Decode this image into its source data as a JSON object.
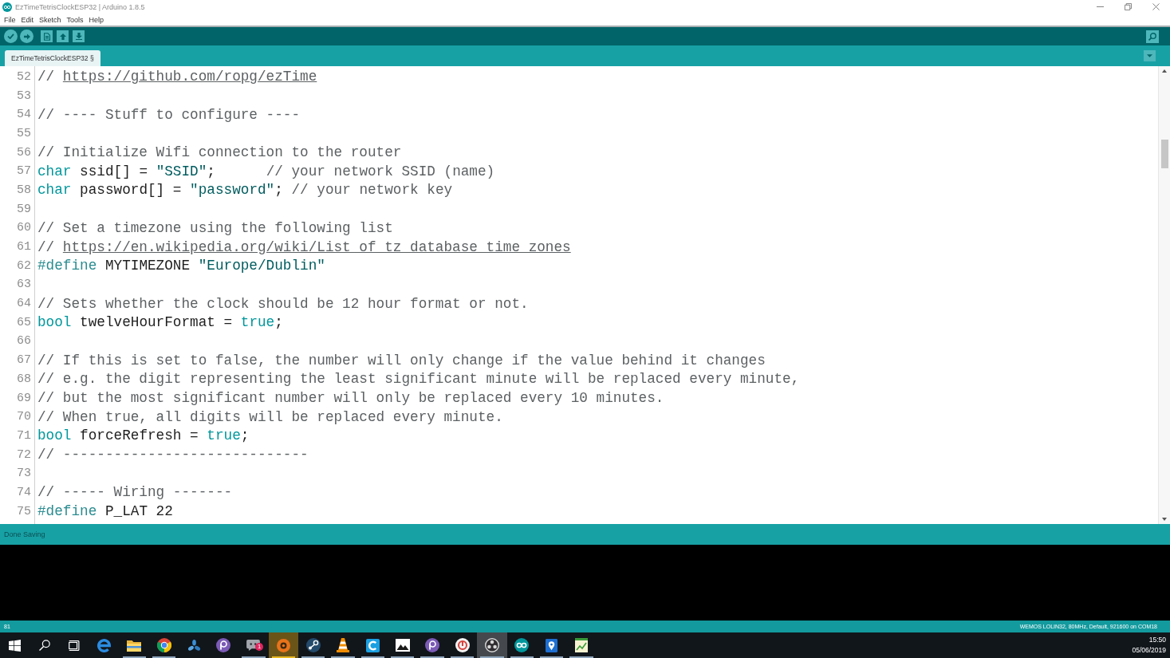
{
  "window": {
    "title": "EzTimeTetrisClockESP32 | Arduino 1.8.5"
  },
  "menu": [
    "File",
    "Edit",
    "Sketch",
    "Tools",
    "Help"
  ],
  "tabs": [
    {
      "label": "EzTimeTetrisClockESP32 §",
      "selected": true
    }
  ],
  "editor": {
    "lines": [
      {
        "number": "52",
        "tokens": [
          {
            "kind": "comment",
            "text": "// "
          },
          {
            "kind": "link",
            "text": "https://github.com/ropg/ezTime"
          }
        ]
      },
      {
        "number": "53"
      },
      {
        "number": "54",
        "tokens": [
          {
            "kind": "comment",
            "text": "// ---- Stuff to configure ----"
          }
        ]
      },
      {
        "number": "55"
      },
      {
        "number": "56",
        "tokens": [
          {
            "kind": "comment",
            "text": "// Initialize Wifi connection to the router"
          }
        ]
      },
      {
        "number": "57",
        "tokens": [
          {
            "kind": "keyword",
            "text": "char"
          },
          {
            "kind": "plain",
            "text": " ssid[] = "
          },
          {
            "kind": "string",
            "text": "\"SSID\""
          },
          {
            "kind": "plain",
            "text": ";      "
          },
          {
            "kind": "comment",
            "text": "// your network SSID (name)"
          }
        ]
      },
      {
        "number": "58",
        "tokens": [
          {
            "kind": "keyword",
            "text": "char"
          },
          {
            "kind": "plain",
            "text": " password[] = "
          },
          {
            "kind": "string",
            "text": "\"password\""
          },
          {
            "kind": "plain",
            "text": "; "
          },
          {
            "kind": "comment",
            "text": "// your network key"
          }
        ]
      },
      {
        "number": "59"
      },
      {
        "number": "60",
        "tokens": [
          {
            "kind": "comment",
            "text": "// Set a timezone using the following list"
          }
        ]
      },
      {
        "number": "61",
        "tokens": [
          {
            "kind": "comment",
            "text": "// "
          },
          {
            "kind": "link",
            "text": "https://en.wikipedia.org/wiki/List_of_tz_database_time_zones"
          }
        ]
      },
      {
        "number": "62",
        "tokens": [
          {
            "kind": "directive",
            "text": "#define"
          },
          {
            "kind": "plain",
            "text": " MYTIMEZONE "
          },
          {
            "kind": "string",
            "text": "\"Europe/Dublin\""
          }
        ]
      },
      {
        "number": "63"
      },
      {
        "number": "64",
        "tokens": [
          {
            "kind": "comment",
            "text": "// Sets whether the clock should be 12 hour format or not."
          }
        ]
      },
      {
        "number": "65",
        "tokens": [
          {
            "kind": "keyword",
            "text": "bool"
          },
          {
            "kind": "plain",
            "text": " twelveHourFormat = "
          },
          {
            "kind": "literal",
            "text": "true"
          },
          {
            "kind": "plain",
            "text": ";"
          }
        ]
      },
      {
        "number": "66"
      },
      {
        "number": "67",
        "tokens": [
          {
            "kind": "comment",
            "text": "// If this is set to false, the number will only change if the value behind it changes"
          }
        ]
      },
      {
        "number": "68",
        "tokens": [
          {
            "kind": "comment",
            "text": "// e.g. the digit representing the least significant minute will be replaced every minute,"
          }
        ]
      },
      {
        "number": "69",
        "tokens": [
          {
            "kind": "comment",
            "text": "// but the most significant number will only be replaced every 10 minutes."
          }
        ]
      },
      {
        "number": "70",
        "tokens": [
          {
            "kind": "comment",
            "text": "// When true, all digits will be replaced every minute."
          }
        ]
      },
      {
        "number": "71",
        "tokens": [
          {
            "kind": "keyword",
            "text": "bool"
          },
          {
            "kind": "plain",
            "text": " forceRefresh = "
          },
          {
            "kind": "literal",
            "text": "true"
          },
          {
            "kind": "plain",
            "text": ";"
          }
        ]
      },
      {
        "number": "72",
        "tokens": [
          {
            "kind": "comment",
            "text": "// -----------------------------"
          }
        ]
      },
      {
        "number": "73"
      },
      {
        "number": "74",
        "tokens": [
          {
            "kind": "comment",
            "text": "// ----- Wiring -------"
          }
        ]
      },
      {
        "number": "75",
        "tokens": [
          {
            "kind": "directive",
            "text": "#define"
          },
          {
            "kind": "plain",
            "text": " P_LAT 22"
          }
        ]
      }
    ]
  },
  "status_bar": {
    "message": "Done Saving"
  },
  "footer": {
    "line": "81",
    "board": "WEMOS LOLIN32, 80MHz, Default, 921600 on COM18"
  },
  "taskbar": {
    "items": [
      {
        "kind": "start",
        "running": false,
        "attention": false,
        "hovered": false
      },
      {
        "kind": "search",
        "running": false,
        "attention": false,
        "hovered": false
      },
      {
        "kind": "taskview",
        "running": false,
        "attention": false,
        "hovered": false
      },
      {
        "kind": "e-browser",
        "running": false,
        "attention": false,
        "hovered": false
      },
      {
        "kind": "folder",
        "running": true,
        "attention": false,
        "hovered": false
      },
      {
        "kind": "ring-browser",
        "running": true,
        "attention": false,
        "hovered": false
      },
      {
        "kind": "fan",
        "running": false,
        "attention": false,
        "hovered": false
      },
      {
        "kind": "disc",
        "running": false,
        "attention": false,
        "hovered": false
      },
      {
        "kind": "chat",
        "running": true,
        "attention": false,
        "hovered": false,
        "badge": "1"
      },
      {
        "kind": "target",
        "running": true,
        "attention": true,
        "hovered": false
      },
      {
        "kind": "link-circle",
        "running": true,
        "attention": false,
        "hovered": false
      },
      {
        "kind": "cone",
        "running": true,
        "attention": false,
        "hovered": false
      },
      {
        "kind": "arc-tile",
        "running": true,
        "attention": false,
        "hovered": false
      },
      {
        "kind": "image",
        "running": true,
        "attention": false,
        "hovered": false
      },
      {
        "kind": "disc",
        "running": true,
        "attention": false,
        "hovered": false
      },
      {
        "kind": "ring",
        "running": true,
        "attention": false,
        "hovered": false
      },
      {
        "kind": "dots",
        "running": true,
        "attention": false,
        "hovered": true
      },
      {
        "kind": "infinity",
        "running": true,
        "attention": false,
        "hovered": false
      },
      {
        "kind": "pin",
        "running": true,
        "attention": false,
        "hovered": false
      },
      {
        "kind": "notepad",
        "running": true,
        "attention": false,
        "hovered": false
      }
    ],
    "clock": {
      "time": "15:50",
      "date": "05/06/2019"
    }
  }
}
